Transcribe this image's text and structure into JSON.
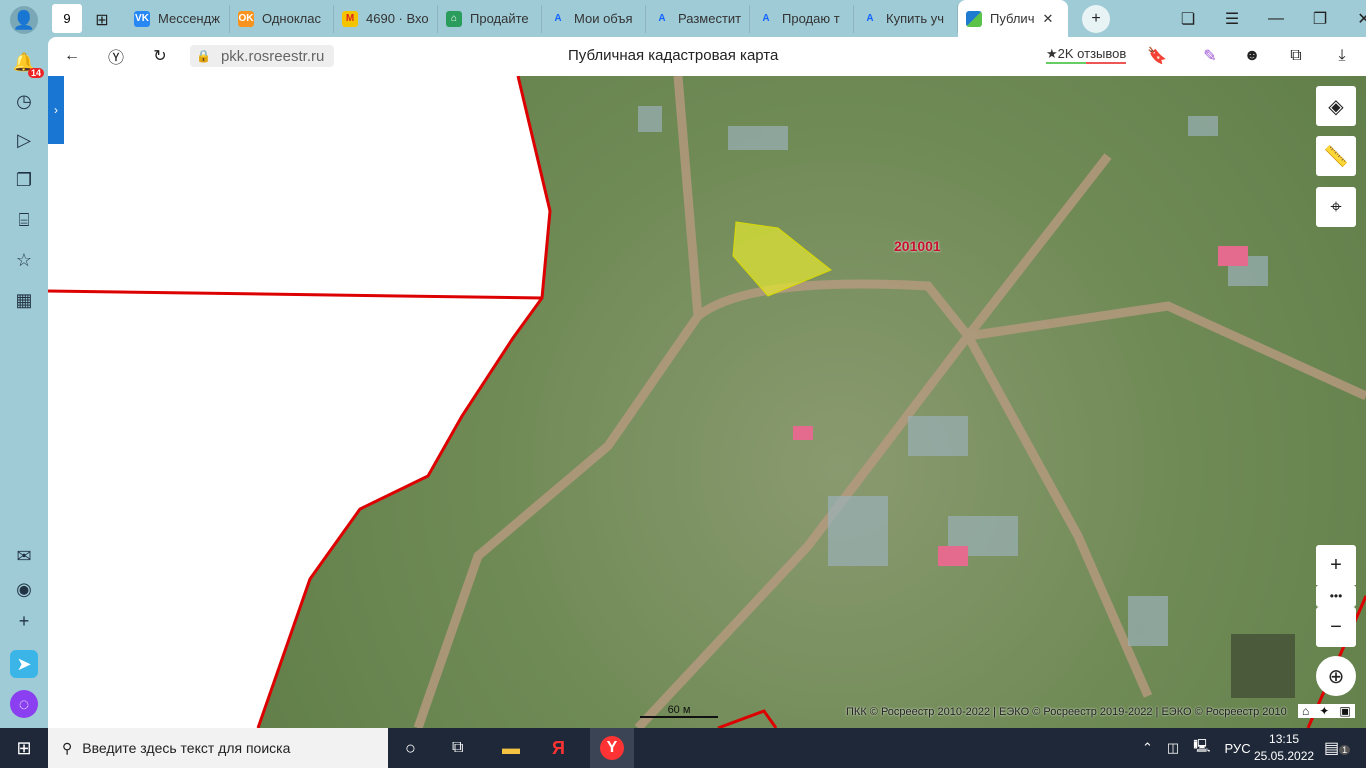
{
  "sidebar": {
    "notification_count": "14"
  },
  "tabs": [
    {
      "label": "Мессендж",
      "color": "#2787f5",
      "glyph": "VK"
    },
    {
      "label": "Одноклас",
      "color": "#f7931e",
      "glyph": "OK"
    },
    {
      "label": "4690 · Вхо",
      "color": "#f5c400",
      "glyph": "M"
    },
    {
      "label": "Продайте",
      "color": "#2a9d5c",
      "glyph": "⌂"
    },
    {
      "label": "Мои объя",
      "color": "#1565ff",
      "glyph": "A"
    },
    {
      "label": "Разместит",
      "color": "#1565ff",
      "glyph": "A"
    },
    {
      "label": "Продаю т",
      "color": "#1565ff",
      "glyph": "A"
    },
    {
      "label": "Купить уч",
      "color": "#1565ff",
      "glyph": "A"
    }
  ],
  "active_tab": {
    "label": "Публич"
  },
  "tab_counter": "9",
  "address": {
    "url": "pkk.rosreestr.ru",
    "title": "Публичная кадастровая карта",
    "reviews": "★2K отзывов"
  },
  "map": {
    "parcel_label": "201001",
    "scale": "60 м",
    "attribution": "ПКК © Росреестр 2010-2022 | ЕЭКО © Росреестр 2019-2022 | ЕЭКО © Росреестр 2010"
  },
  "taskbar": {
    "search_placeholder": "Введите здесь текст для поиска",
    "lang": "РУС",
    "time": "13:15",
    "date": "25.05.2022",
    "notif": "1"
  }
}
